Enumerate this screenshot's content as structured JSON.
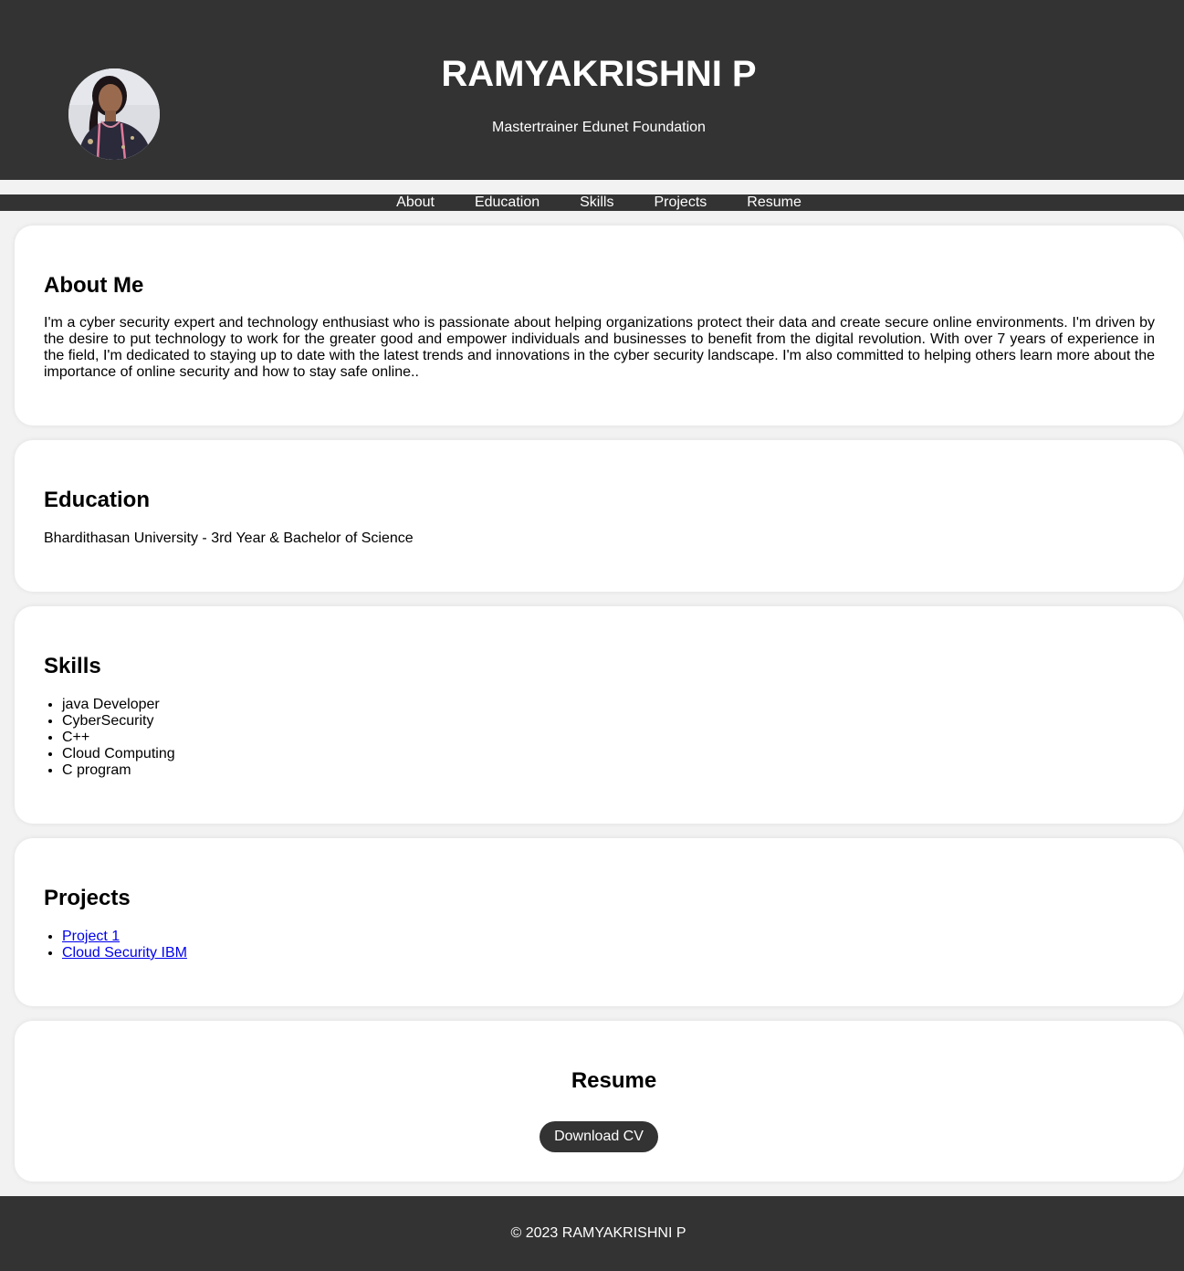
{
  "header": {
    "name": "RAMYAKRISHNI P",
    "subtitle": "Mastertrainer Edunet Foundation"
  },
  "nav": {
    "items": [
      "About",
      "Education",
      "Skills",
      "Projects",
      "Resume"
    ]
  },
  "about": {
    "heading": "About Me",
    "text": "I'm a cyber security expert and technology enthusiast who is passionate about helping organizations protect their data and create secure online environments. I'm driven by the desire to put technology to work for the greater good and empower individuals and businesses to benefit from the digital revolution. With over 7 years of experience in the field, I'm dedicated to staying up to date with the latest trends and innovations in the cyber security landscape. I'm also committed to helping others learn more about the importance of online security and how to stay safe online.."
  },
  "education": {
    "heading": "Education",
    "text": "Bhardithasan University - 3rd Year & Bachelor of Science"
  },
  "skills": {
    "heading": "Skills",
    "items": [
      "java Developer",
      "CyberSecurity",
      "C++",
      "Cloud Computing",
      "C program"
    ]
  },
  "projects": {
    "heading": "Projects",
    "items": [
      "Project 1",
      "Cloud Security IBM"
    ]
  },
  "resume": {
    "heading": "Resume",
    "button_label": "Download CV"
  },
  "footer": {
    "text": "© 2023 RAMYAKRISHNI P"
  },
  "colors": {
    "header_bg": "#333333",
    "page_bg": "#f2f2f2",
    "card_bg": "#ffffff",
    "link": "#0000ee"
  }
}
